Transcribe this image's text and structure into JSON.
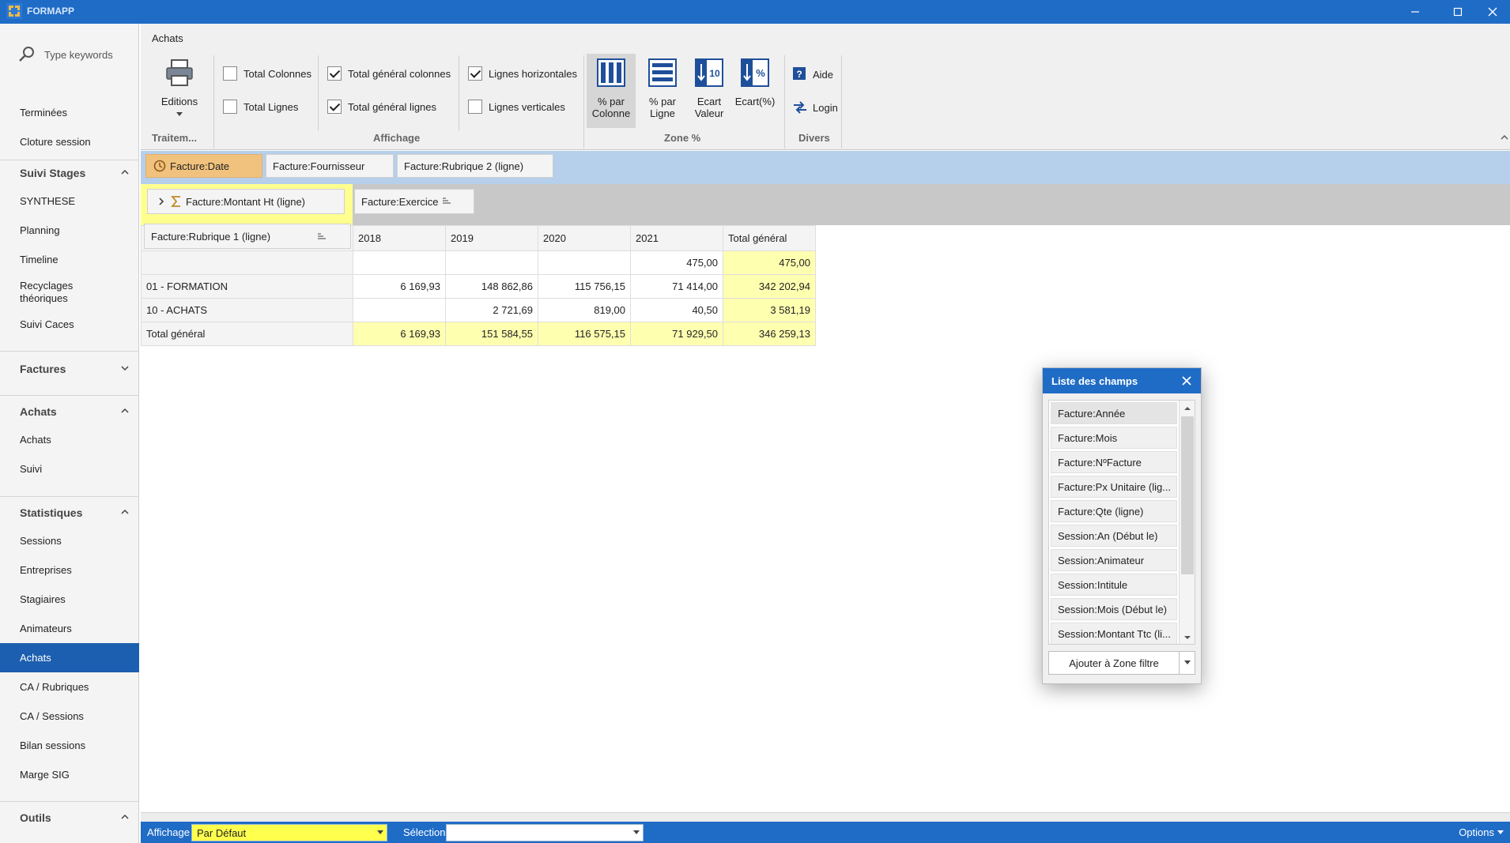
{
  "app": {
    "title": "FORMAPP"
  },
  "sidebar": {
    "search_placeholder": "Type keywords",
    "top_items": [
      "Terminées",
      "Cloture session"
    ],
    "sections": [
      {
        "title": "Suivi Stages",
        "expanded": true,
        "items": [
          "SYNTHESE",
          "Planning",
          "Timeline",
          "Recyclages théoriques",
          "Suivi Caces"
        ]
      },
      {
        "title": "Factures",
        "expanded": false,
        "items": []
      },
      {
        "title": "Achats",
        "expanded": true,
        "items": [
          "Achats",
          "Suivi"
        ]
      },
      {
        "title": "Statistiques",
        "expanded": true,
        "items": [
          "Sessions",
          "Entreprises",
          "Stagiaires",
          "Animateurs",
          "Achats",
          "CA / Rubriques",
          "CA / Sessions",
          "Bilan sessions",
          "Marge SIG"
        ]
      },
      {
        "title": "Outils",
        "expanded": true,
        "items": []
      }
    ],
    "active_item": "Achats"
  },
  "ribbon": {
    "tab": "Achats",
    "editions": "Editions",
    "groups": {
      "traitement": "Traitem...",
      "affichage": "Affichage",
      "zone": "Zone %",
      "divers": "Divers"
    },
    "checks": {
      "total_colonnes": {
        "label": "Total Colonnes",
        "checked": false
      },
      "total_lignes": {
        "label": "Total Lignes",
        "checked": false
      },
      "total_general_colonnes": {
        "label": "Total général colonnes",
        "checked": true
      },
      "total_general_lignes": {
        "label": "Total général lignes",
        "checked": true
      },
      "lignes_horizontales": {
        "label": "Lignes horizontales",
        "checked": true
      },
      "lignes_verticales": {
        "label": "Lignes verticales",
        "checked": false
      }
    },
    "zone": {
      "pct_colonne": [
        "% par",
        "Colonne"
      ],
      "pct_ligne": [
        "% par",
        "Ligne"
      ],
      "ecart_valeur": [
        "Ecart",
        "Valeur"
      ],
      "ecart_pct": "Ecart(%)"
    },
    "aide": "Aide",
    "login": "Login"
  },
  "pivot": {
    "filter_fields": [
      "Facture:Date",
      "Facture:Fournisseur",
      "Facture:Rubrique 2 (ligne)"
    ],
    "data_field": "Facture:Montant Ht (ligne)",
    "column_field": "Facture:Exercice",
    "row_field": "Facture:Rubrique 1 (ligne)",
    "columns": [
      "2018",
      "2019",
      "2020",
      "2021",
      "Total général"
    ],
    "rows": [
      {
        "label": "",
        "values": [
          "",
          "",
          "",
          "475,00",
          "475,00"
        ]
      },
      {
        "label": "01 - FORMATION",
        "values": [
          "6 169,93",
          "148 862,86",
          "115 756,15",
          "71 414,00",
          "342 202,94"
        ]
      },
      {
        "label": "10 - ACHATS",
        "values": [
          "",
          "2 721,69",
          "819,00",
          "40,50",
          "3 581,19"
        ]
      },
      {
        "label": "Total général",
        "values": [
          "6 169,93",
          "151 584,55",
          "116 575,15",
          "71 929,50",
          "346 259,13"
        ]
      }
    ]
  },
  "fieldlist": {
    "title": "Liste des champs",
    "items": [
      "Facture:Année",
      "Facture:Mois",
      "Facture:NºFacture",
      "Facture:Px Unitaire (lig...",
      "Facture:Qte (ligne)",
      "Session:An (Début le)",
      "Session:Animateur",
      "Session:Intitule",
      "Session:Mois (Début le)",
      "Session:Montant Ttc (li..."
    ],
    "add_button": "Ajouter à Zone filtre"
  },
  "status": {
    "affichage_label": "Affichage",
    "affichage_value": "Par Défaut",
    "selection_label": "Sélection",
    "selection_value": "",
    "options": "Options"
  },
  "colors": {
    "accent": "#1f6cc6",
    "active": "#1c5fb0",
    "highlight": "#ffff8f"
  }
}
